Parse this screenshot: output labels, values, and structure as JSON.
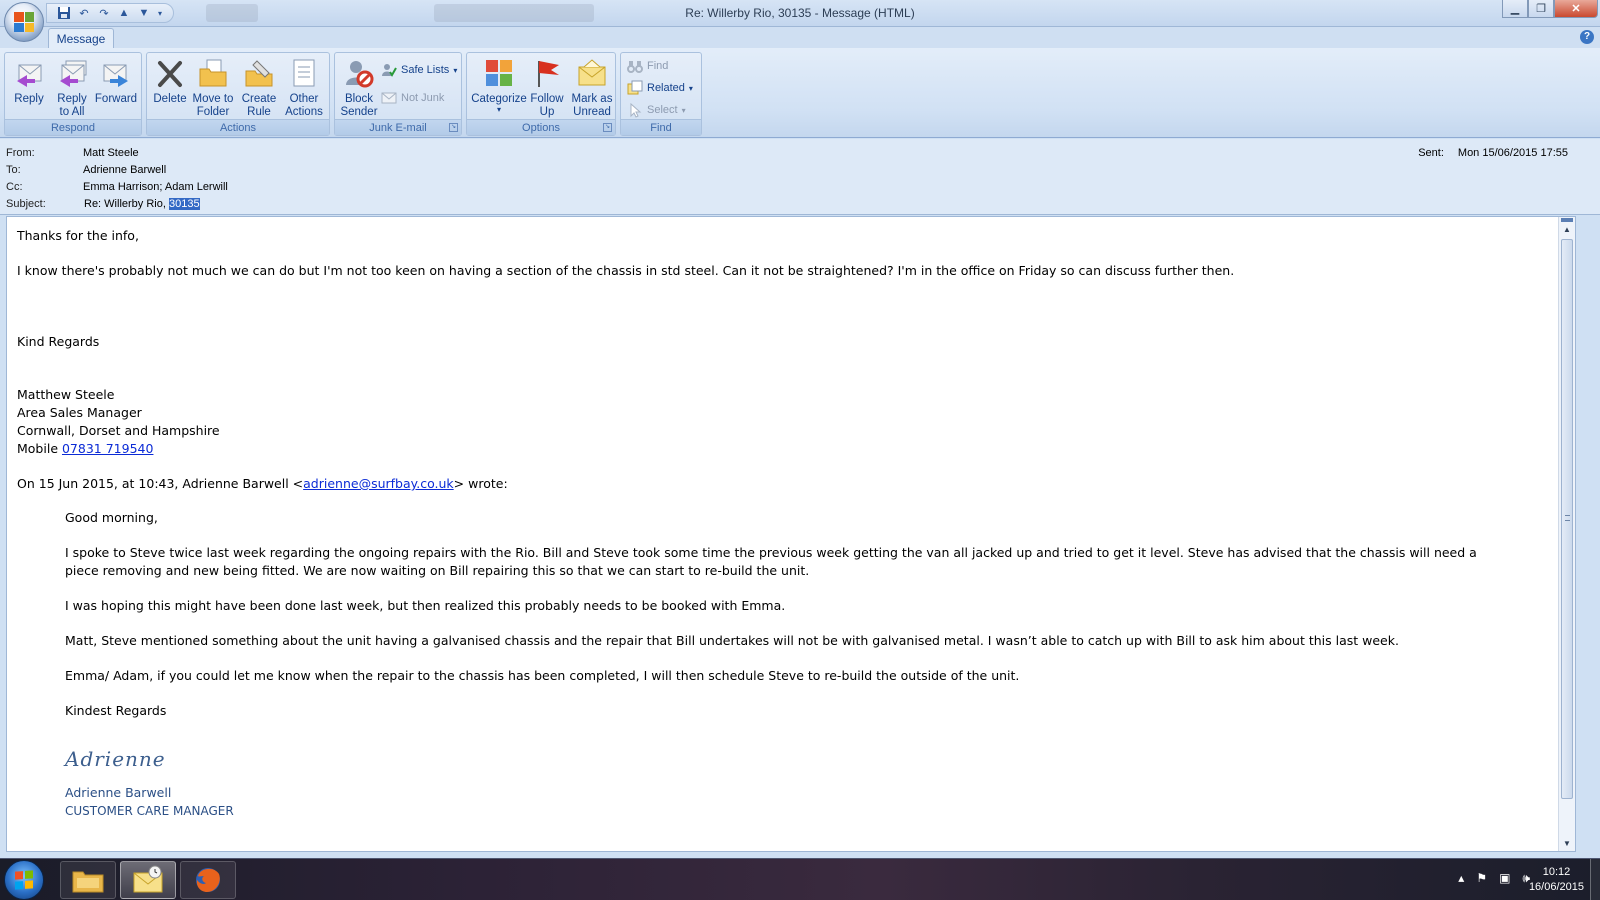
{
  "window": {
    "title": "Re: Willerby Rio, 30135 - Message (HTML)",
    "minimize_icon": "minimize-icon",
    "restore_icon": "restore-icon",
    "close_icon": "close-icon"
  },
  "tabs": [
    {
      "label": "Message"
    }
  ],
  "ribbon": {
    "groups": {
      "respond": {
        "label": "Respond",
        "buttons": [
          {
            "label": "Reply",
            "icon": "reply-icon"
          },
          {
            "label": "Reply to All",
            "icon": "reply-all-icon"
          },
          {
            "label": "Forward",
            "icon": "forward-icon"
          }
        ]
      },
      "actions": {
        "label": "Actions",
        "buttons": [
          {
            "label": "Delete",
            "icon": "delete-icon"
          },
          {
            "label": "Move to Folder",
            "icon": "move-folder-icon"
          },
          {
            "label": "Create Rule",
            "icon": "create-rule-icon"
          },
          {
            "label": "Other Actions",
            "icon": "other-actions-icon"
          }
        ]
      },
      "junk": {
        "label": "Junk E-mail",
        "block_sender": "Block Sender",
        "safe_lists": "Safe Lists",
        "not_junk": "Not Junk"
      },
      "options": {
        "label": "Options",
        "categorize": "Categorize",
        "follow_up": "Follow Up",
        "mark_unread": "Mark as Unread"
      },
      "find": {
        "label": "Find",
        "find": "Find",
        "related": "Related",
        "select": "Select"
      }
    }
  },
  "headers": {
    "from_label": "From:",
    "from": "Matt Steele",
    "to_label": "To:",
    "to": "Adrienne Barwell",
    "cc_label": "Cc:",
    "cc": "Emma Harrison; Adam Lerwill",
    "subject_label": "Subject:",
    "subject_prefix": "Re: Willerby Rio, ",
    "subject_selected": "30135",
    "sent_label": "Sent:",
    "sent": "Mon 15/06/2015 17:55"
  },
  "body": {
    "greeting": "Thanks for the info,",
    "para1": "I know there's probably not much we can do but I'm not too keen on having a section of the chassis in std steel. Can it not be straightened? I'm in the office on Friday so can discuss further then.",
    "closing": "Kind Regards",
    "sig_name": "Matthew Steele",
    "sig_title": "Area Sales Manager",
    "sig_region": "Cornwall, Dorset and Hampshire",
    "sig_mobile_label": "Mobile ",
    "sig_mobile": "07831 719540",
    "quote_intro_pre": "On 15 Jun 2015, at 10:43, Adrienne Barwell <",
    "quote_email": "adrienne@surfbay.co.uk",
    "quote_intro_post": "> wrote:",
    "quote": {
      "greeting": "Good morning,",
      "p1": "I spoke to Steve twice last week regarding the ongoing repairs with the Rio.  Bill and Steve took some time the previous week getting the van all jacked up and tried to get it level.  Steve has advised that the chassis will need a piece removing and new being fitted.    We are now waiting on Bill repairing this so that we can start to re-build the unit.",
      "p2": "I was hoping this might have been done last week, but then realized this probably needs to be booked with Emma.",
      "p3": "Matt, Steve mentioned something about the unit having a galvanised chassis and the repair that Bill undertakes will not be with galvanised metal.  I wasn’t able to catch up with Bill to ask him about this last week.",
      "p4": "Emma/ Adam, if you could let me know when the repair to the chassis has been completed, I will then schedule Steve to re-build the outside of the unit.",
      "closing": "Kindest Regards",
      "sig_script": "Adrienne",
      "sig_name": "Adrienne Barwell",
      "sig_title": "CUSTOMER CARE MANAGER"
    }
  },
  "taskbar": {
    "clock_time": "10:12",
    "clock_date": "16/06/2015",
    "apps": [
      "explorer-icon",
      "outlook-icon",
      "firefox-icon"
    ]
  },
  "colors": {
    "accent": "#15428b",
    "link": "#0b2bd6",
    "selection": "#3369c5"
  }
}
